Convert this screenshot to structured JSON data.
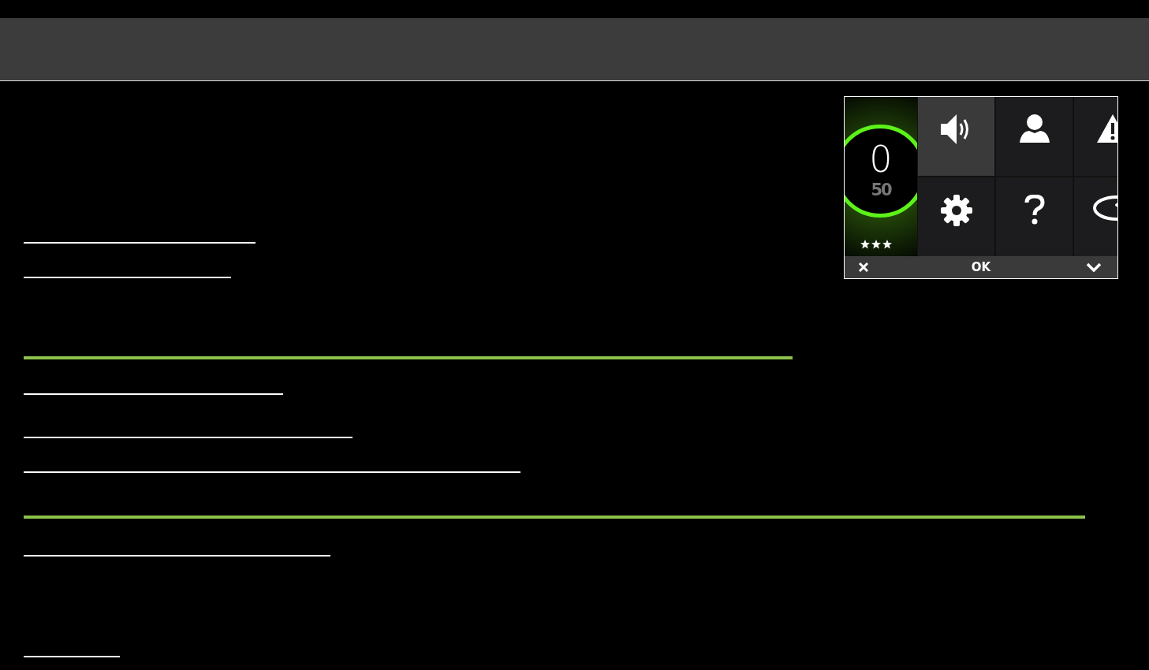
{
  "device": {
    "score": "0",
    "target": "50",
    "stars": 3,
    "tiles": [
      {
        "kind": "sound",
        "selected": true
      },
      {
        "kind": "user",
        "selected": false
      },
      {
        "kind": "warning",
        "selected": false
      },
      {
        "kind": "settings",
        "selected": false
      },
      {
        "kind": "help",
        "selected": false
      },
      {
        "kind": "disc",
        "selected": false
      }
    ],
    "footer": {
      "ok": "OK"
    }
  }
}
